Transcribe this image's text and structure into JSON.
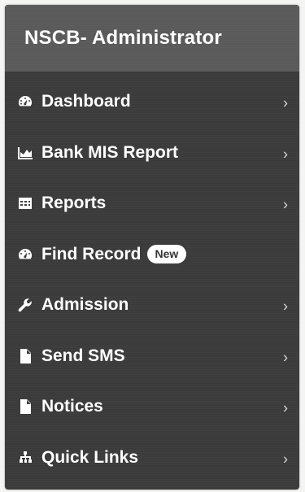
{
  "header": {
    "title": "NSCB- Administrator"
  },
  "menu": [
    {
      "label": "Dashboard",
      "icon": "dashboard-icon",
      "chevron": "›"
    },
    {
      "label": "Bank MIS Report",
      "icon": "area-chart-icon",
      "chevron": "›"
    },
    {
      "label": "Reports",
      "icon": "table-icon",
      "chevron": "›"
    },
    {
      "label": "Find Record",
      "icon": "dashboard-icon",
      "badge": "New"
    },
    {
      "label": "Admission",
      "icon": "wrench-icon",
      "chevron": "›"
    },
    {
      "label": "Send SMS",
      "icon": "file-icon",
      "chevron": "›"
    },
    {
      "label": "Notices",
      "icon": "file-icon",
      "chevron": "›"
    },
    {
      "label": "Quick Links",
      "icon": "sitemap-icon",
      "chevron": "›"
    }
  ],
  "colors": {
    "header_bg": "#5a5a5a",
    "sidebar_bg": "#3b3b3b",
    "text": "#ffffff",
    "badge_bg": "#ffffff"
  }
}
